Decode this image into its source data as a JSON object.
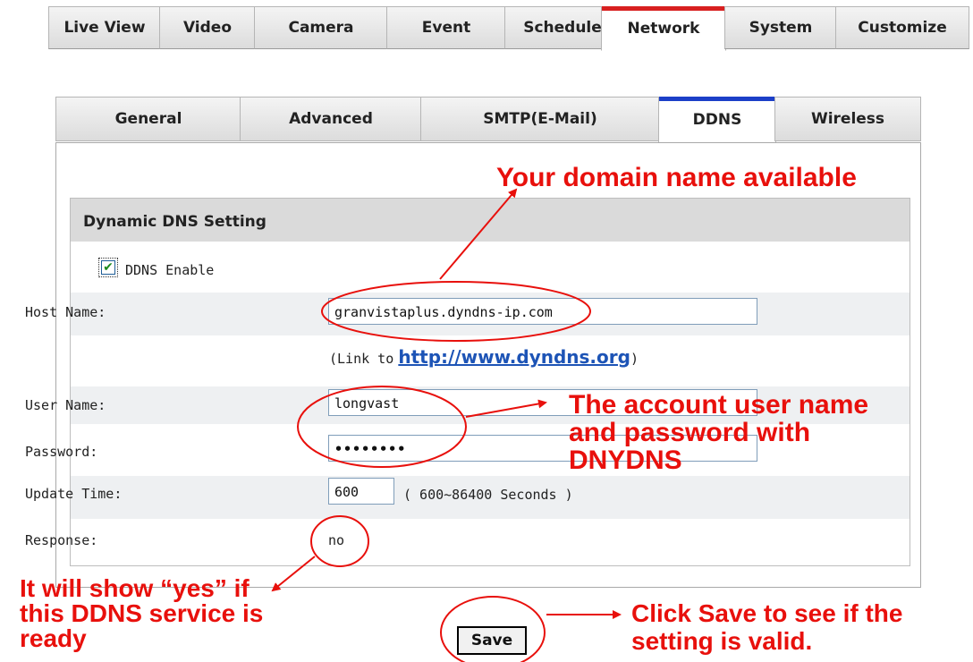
{
  "top_tabs": [
    "Live View",
    "Video",
    "Camera",
    "Event",
    "Schedule",
    "Network",
    "System",
    "Customize"
  ],
  "top_active": "Network",
  "sub_tabs": [
    "General",
    "Advanced",
    "SMTP(E-Mail)",
    "DDNS",
    "Wireless"
  ],
  "sub_active": "DDNS",
  "panel_title": "Dynamic DNS Setting",
  "ddns_enable": {
    "label": "DDNS Enable",
    "checked": true,
    "check_glyph": "✔"
  },
  "host_name": {
    "label": "Host Name:",
    "value": "granvistaplus.dyndns-ip.com"
  },
  "link": {
    "prefix": "(Link to",
    "url": "http://www.dyndns.org",
    "suffix": ")"
  },
  "user_name": {
    "label": "User Name:",
    "value": "longvast"
  },
  "password": {
    "label": "Password:",
    "value": "••••••••"
  },
  "update_time": {
    "label": "Update Time:",
    "value": "600",
    "range": "( 600~86400 Seconds )"
  },
  "response": {
    "label": "Response:",
    "value": "no"
  },
  "save_label": "Save",
  "annotations": {
    "domain": "Your domain name available",
    "account_line1": "The account user name",
    "account_line2": "and password with",
    "account_line3": "DNYDNS",
    "yes_line1": "It will show “yes” if",
    "yes_line2": "this DDNS service is",
    "yes_line3": "ready",
    "save_line1": "Click Save to see if the",
    "save_line2": "setting is valid."
  },
  "colors": {
    "annotation": "#e8100c",
    "network_tab_bar": "#d82020",
    "ddns_tab_bar": "#1c3fc8",
    "link": "#1d54b6"
  }
}
